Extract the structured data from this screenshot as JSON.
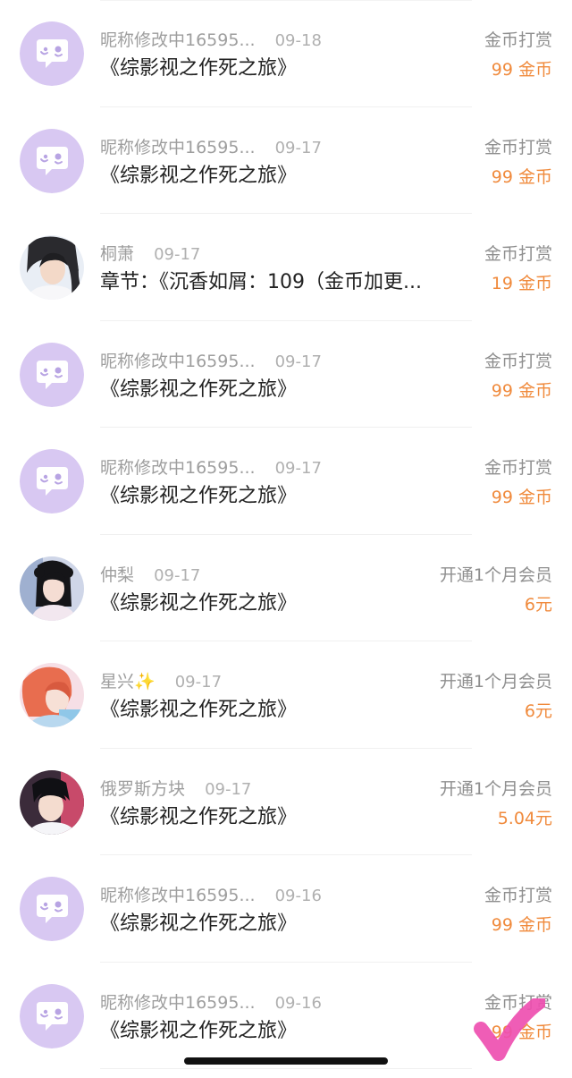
{
  "items": [
    {
      "name": "昵称修改中16595...",
      "date": "09-18",
      "type": "金币打赏",
      "title": "《综影视之作死之旅》",
      "amount": "99 金币",
      "avatar": "default-chat"
    },
    {
      "name": "昵称修改中16595...",
      "date": "09-17",
      "type": "金币打赏",
      "title": "《综影视之作死之旅》",
      "amount": "99 金币",
      "avatar": "default-chat"
    },
    {
      "name": "桐萧",
      "date": "09-17",
      "type": "金币打赏",
      "title": "章节：《沉香如屑：109（金币加更...",
      "amount": "19 金币",
      "avatar": "photo-boy-1"
    },
    {
      "name": "昵称修改中16595...",
      "date": "09-17",
      "type": "金币打赏",
      "title": "《综影视之作死之旅》",
      "amount": "99 金币",
      "avatar": "default-chat"
    },
    {
      "name": "昵称修改中16595...",
      "date": "09-17",
      "type": "金币打赏",
      "title": "《综影视之作死之旅》",
      "amount": "99 金币",
      "avatar": "default-chat"
    },
    {
      "name": "仲梨",
      "date": "09-17",
      "type": "开通1个月会员",
      "title": "《综影视之作死之旅》",
      "amount": "6元",
      "avatar": "photo-girl-1"
    },
    {
      "name": "星兴✨",
      "date": "09-17",
      "type": "开通1个月会员",
      "title": "《综影视之作死之旅》",
      "amount": "6元",
      "avatar": "photo-girl-2"
    },
    {
      "name": "俄罗斯方块",
      "date": "09-17",
      "type": "开通1个月会员",
      "title": "《综影视之作死之旅》",
      "amount": "5.04元",
      "avatar": "photo-boy-2"
    },
    {
      "name": "昵称修改中16595...",
      "date": "09-16",
      "type": "金币打赏",
      "title": "《综影视之作死之旅》",
      "amount": "99 金币",
      "avatar": "default-chat"
    },
    {
      "name": "昵称修改中16595...",
      "date": "09-16",
      "type": "金币打赏",
      "title": "《综影视之作死之旅》",
      "amount": "99 金币",
      "avatar": "default-chat"
    }
  ],
  "colors": {
    "amount": "#f08a3c",
    "avatar_default": "#d8c8f2",
    "check_overlay": "#ee4fb0"
  },
  "icons": {
    "default_avatar": "chat-bubble-icon",
    "overlay": "checkmark-icon"
  }
}
